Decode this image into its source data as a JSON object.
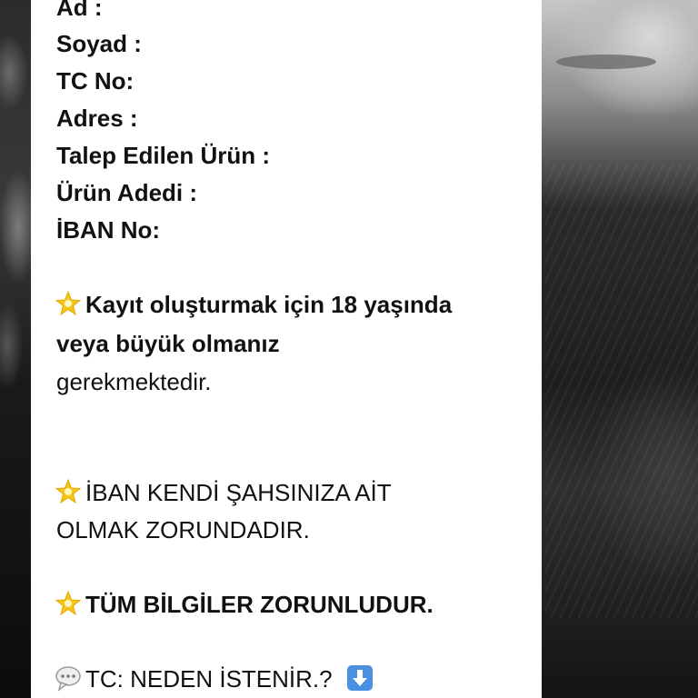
{
  "form_fields": [
    "Ad :",
    "Soyad :",
    "TC No:",
    "Adres :",
    "Talep Edilen Ürün :",
    "Ürün Adedi :",
    "İBAN No:"
  ],
  "notes": {
    "age_line1": "Kayıt oluşturmak için 18 yaşında",
    "age_line2": "veya büyük olmanız",
    "age_line3": "gerekmektedir.",
    "iban_line1": "İBAN KENDİ ŞAHSINIZA AİT",
    "iban_line2": "OLMAK ZORUNDADIR.",
    "required": "TÜM BİLGİLER ZORUNLUDUR.",
    "tc_question": "TC: NEDEN İSTENİR.?"
  },
  "icons": {
    "star": "glowing-star-icon",
    "speech": "speech-bubble-icon",
    "arrow": "down-arrow-icon"
  },
  "colors": {
    "star": "#f5c518",
    "arrow_bg": "#4a90e2"
  }
}
